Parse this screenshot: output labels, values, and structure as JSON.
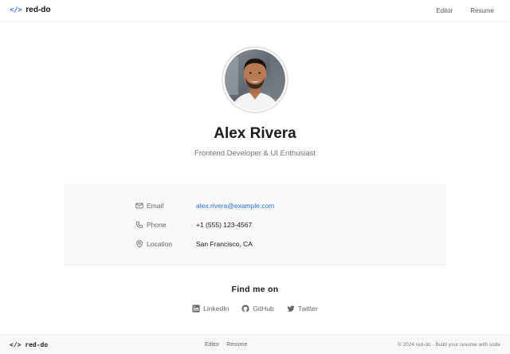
{
  "header": {
    "brand_icon": "</>",
    "brand_name": "red-do",
    "nav": [
      "Editor",
      "Resume"
    ]
  },
  "profile": {
    "avatar_icon": "avatar-photo",
    "name": "Alex Rivera",
    "tagline": "Frontend Developer & UI Enthusiast"
  },
  "contact": [
    {
      "icon": "mail-icon",
      "label": "Email",
      "value": "alex.rivera@example.com",
      "is_link": true
    },
    {
      "icon": "phone-icon",
      "label": "Phone",
      "value": "+1 (555) 123-4567",
      "is_link": false
    },
    {
      "icon": "location-pin-icon",
      "label": "Location",
      "value": "San Francisco, CA",
      "is_link": false
    }
  ],
  "social": {
    "title": "Find me on",
    "links": [
      {
        "icon": "linkedin-icon",
        "label": "LinkedIn"
      },
      {
        "icon": "github-icon",
        "label": "GitHub"
      },
      {
        "icon": "twitter-icon",
        "label": "Twitter"
      }
    ]
  },
  "footer": {
    "brand": "</> red-do",
    "nav": [
      "Editor",
      "Resume"
    ],
    "copyright": "© 2024 red-do · Build your resume with code"
  },
  "colors": {
    "accent": "#2e73d8",
    "card_bg": "#f7f8fa",
    "text": "#1a1a1a",
    "muted": "#666666"
  }
}
